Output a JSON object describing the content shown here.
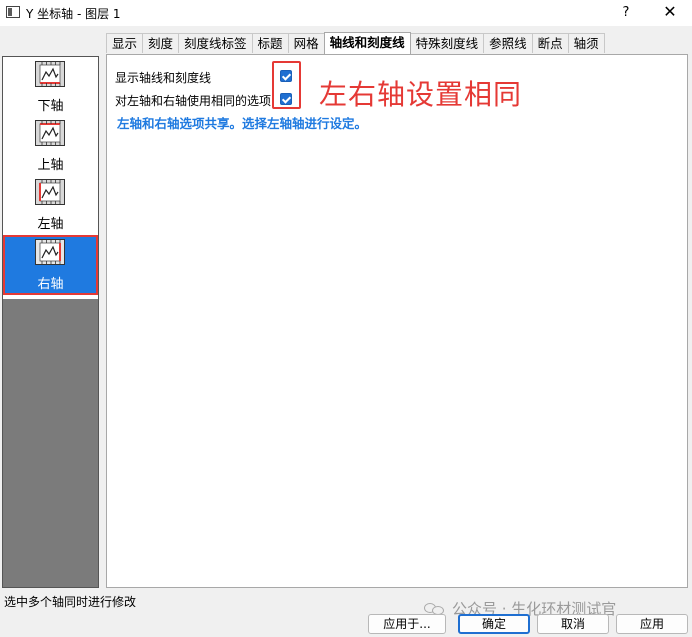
{
  "window": {
    "title": "Y 坐标轴 - 图层 1",
    "help": "?",
    "close": "✕"
  },
  "tabs": [
    "显示",
    "刻度",
    "刻度线标签",
    "标题",
    "网格",
    "轴线和刻度线",
    "特殊刻度线",
    "参照线",
    "断点",
    "轴须"
  ],
  "active_tab": "轴线和刻度线",
  "axis_list": [
    {
      "label": "下轴",
      "edge": "bottom"
    },
    {
      "label": "上轴",
      "edge": "top"
    },
    {
      "label": "左轴",
      "edge": "left"
    },
    {
      "label": "右轴",
      "edge": "right",
      "selected": true
    }
  ],
  "options": {
    "show_axis_label": "显示轴线和刻度线",
    "show_axis_checked": true,
    "same_options_label": "对左轴和右轴使用相同的选项",
    "same_options_checked": true
  },
  "annotation": "左右轴设置相同",
  "info_text": "左轴和右轴选项共享。选择左轴轴进行设定。",
  "status_text": "选中多个轴同时进行修改",
  "watermark": "公众号 · 生化环材测试官",
  "buttons": {
    "apply_to": "应用于...",
    "ok": "确定",
    "cancel": "取消",
    "apply": "应用"
  },
  "colors": {
    "selection": "#1f7ae0",
    "annotation_red": "#e53935",
    "info_blue": "#1f7ae0"
  }
}
